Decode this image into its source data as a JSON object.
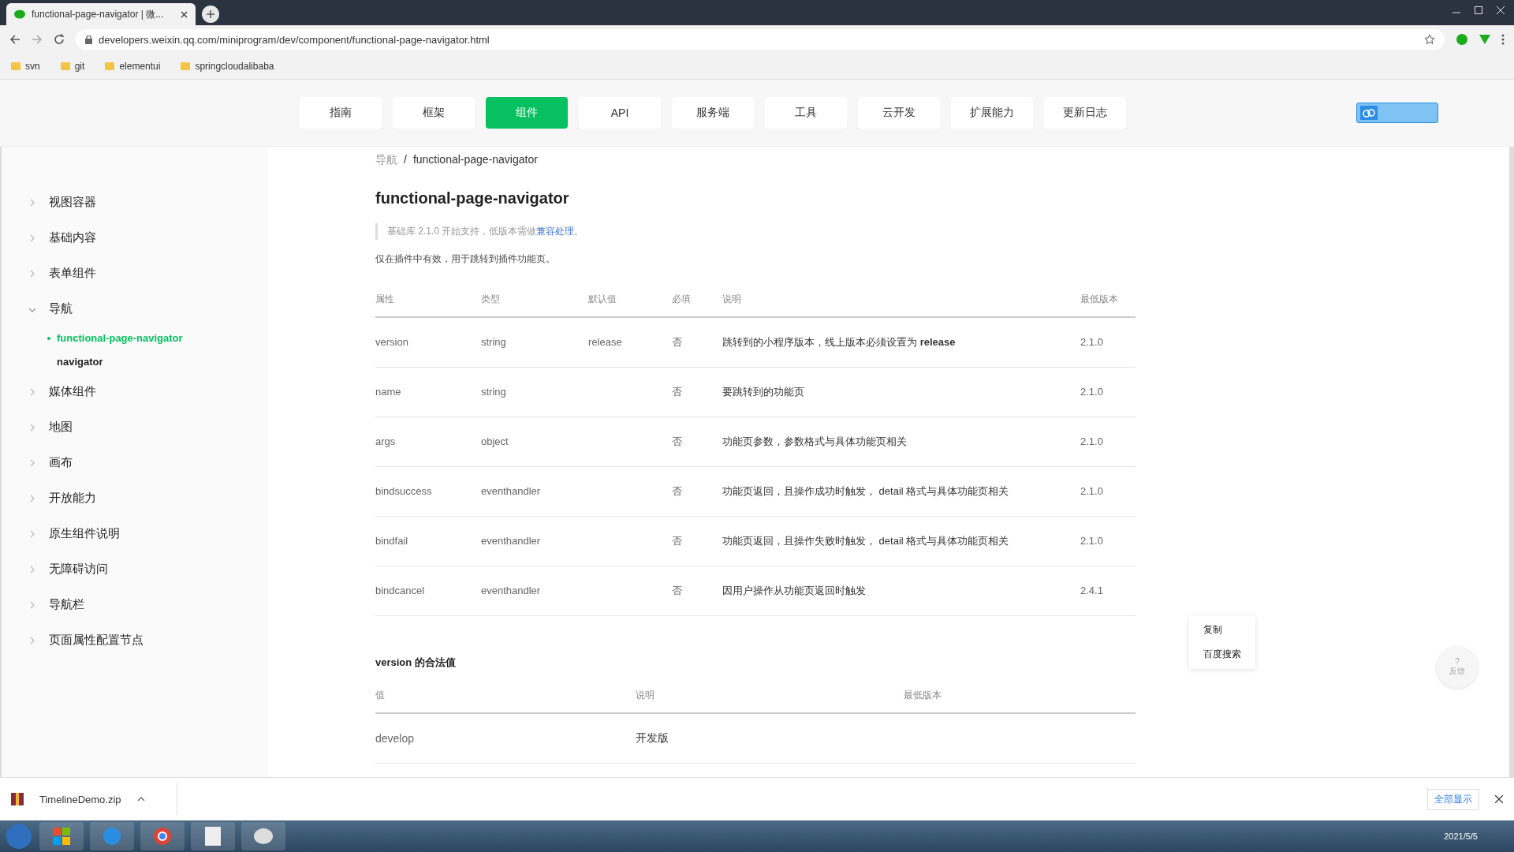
{
  "browser": {
    "tab_title": "functional-page-navigator | 微...",
    "url": "developers.weixin.qq.com/miniprogram/dev/component/functional-page-navigator.html",
    "bookmarks": [
      "svn",
      "git",
      "elementui",
      "springcloudalibaba"
    ]
  },
  "nav": {
    "items": [
      {
        "label": "指南",
        "selected": false
      },
      {
        "label": "框架",
        "selected": false
      },
      {
        "label": "组件",
        "selected": true
      },
      {
        "label": "API",
        "selected": false
      },
      {
        "label": "服务端",
        "selected": false
      },
      {
        "label": "工具",
        "selected": false
      },
      {
        "label": "云开发",
        "selected": false
      },
      {
        "label": "扩展能力",
        "selected": false
      },
      {
        "label": "更新日志",
        "selected": false
      }
    ]
  },
  "sidebar": {
    "items": [
      {
        "label": "视图容器",
        "expanded": false
      },
      {
        "label": "基础内容",
        "expanded": false
      },
      {
        "label": "表单组件",
        "expanded": false
      },
      {
        "label": "导航",
        "expanded": true,
        "children": [
          {
            "label": "functional-page-navigator",
            "selected": true
          },
          {
            "label": "navigator",
            "selected": false
          }
        ]
      },
      {
        "label": "媒体组件",
        "expanded": false
      },
      {
        "label": "地图",
        "expanded": false
      },
      {
        "label": "画布",
        "expanded": false
      },
      {
        "label": "开放能力",
        "expanded": false
      },
      {
        "label": "原生组件说明",
        "expanded": false
      },
      {
        "label": "无障碍访问",
        "expanded": false
      },
      {
        "label": "导航栏",
        "expanded": false
      },
      {
        "label": "页面属性配置节点",
        "expanded": false
      }
    ]
  },
  "breadcrumb": {
    "separator": "/",
    "items": [
      "导航",
      "functional-page-navigator"
    ]
  },
  "title": "functional-page-navigator",
  "note": {
    "text": "基础库 2.1.0 开始支持，低版本需做",
    "link": "兼容处理",
    "end": "。"
  },
  "description": "仅在插件中有效，用于跳转到插件功能页。",
  "props_table": {
    "columns": [
      "属性",
      "类型",
      "默认值",
      "必填",
      "说明",
      "最低版本"
    ],
    "rows": [
      [
        "version",
        "string",
        "release",
        "否",
        "跳转到的小程序版本，线上版本必须设置为 **release**",
        "2.1.0"
      ],
      [
        "name",
        "string",
        "",
        "否",
        "要跳转到的功能页",
        "2.1.0"
      ],
      [
        "args",
        "object",
        "",
        "否",
        "功能页参数，参数格式与具体功能页相关",
        "2.1.0"
      ],
      [
        "bindsuccess",
        "eventhandler",
        "",
        "否",
        "功能页返回，且操作成功时触发， detail 格式与具体功能页相关",
        "2.1.0"
      ],
      [
        "bindfail",
        "eventhandler",
        "",
        "否",
        "功能页返回，且操作失败时触发， detail 格式与具体功能页相关",
        "2.1.0"
      ],
      [
        "bindcancel",
        "eventhandler",
        "",
        "否",
        "因用户操作从功能页返回时触发",
        "2.4.1"
      ]
    ]
  },
  "values_section": {
    "title": "version 的合法值",
    "columns": [
      "值",
      "说明",
      "最低版本"
    ],
    "rows": [
      [
        "develop",
        "开发版"
      ]
    ]
  },
  "context_menu": [
    "复制",
    "百度搜索"
  ],
  "help_button": {
    "mark": "?",
    "label": "反馈"
  },
  "downloads": {
    "file": "TimelineDemo.zip",
    "show_all": "全部显示"
  },
  "taskbar": {
    "date": "2021/5/5"
  }
}
